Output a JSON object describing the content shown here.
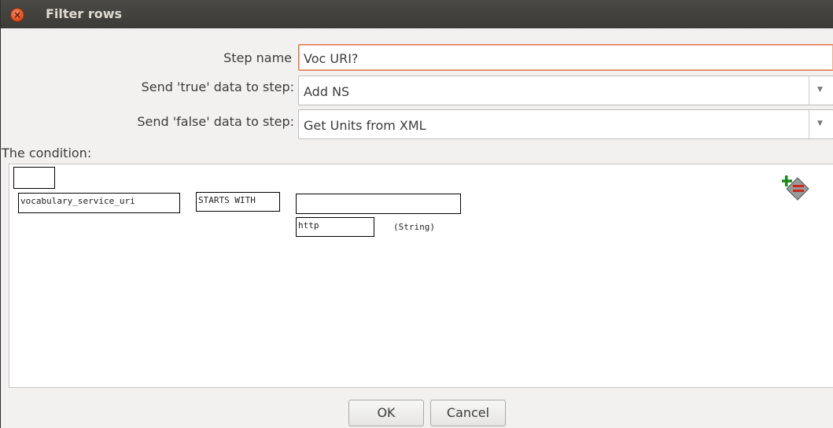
{
  "window": {
    "title": "Filter rows"
  },
  "form": {
    "step_name_label": "Step name",
    "step_name_value": "Voc URI?",
    "true_label": "Send 'true' data to step:",
    "true_value": "Add NS",
    "false_label": "Send 'false' data to step:",
    "false_value": "Get Units from XML"
  },
  "condition": {
    "label": "The condition:",
    "field": "vocabulary_service_uri",
    "function": "STARTS WITH",
    "compare_field": "",
    "value": "http",
    "value_type": "(String)"
  },
  "buttons": {
    "ok": "OK",
    "cancel": "Cancel"
  },
  "icons": {
    "close": "close-icon",
    "add_condition": "add-condition-icon"
  },
  "colors": {
    "titlebar": "#3c3b37",
    "close": "#df4a16",
    "focus": "#e07b53",
    "add_icon_green": "#1a8a1a"
  }
}
